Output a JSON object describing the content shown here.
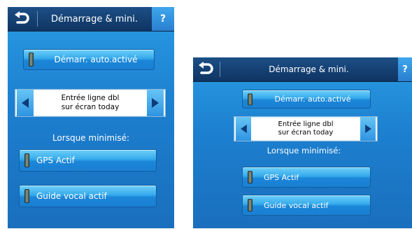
{
  "title": "Démarrage & mini.",
  "help_label": "?",
  "autostart_label": "Démarr. auto.activé",
  "today_line1": "Entrée ligne dbl",
  "today_line2": "sur écran today",
  "minimized_label": "Lorsque minimisé:",
  "gps_label": "GPS Actif",
  "voice_label": "Guide vocal actif",
  "colors": {
    "screen_top": "#2a9be3",
    "screen_bottom": "#1a6fbd",
    "title_bar": "#133f72",
    "button": "#2aa0ea",
    "help": "#3fa6ec"
  },
  "icons": {
    "back": "back-arrow-icon",
    "left": "left-arrow-icon",
    "right": "right-arrow-icon",
    "indicator": "indicator-icon"
  }
}
